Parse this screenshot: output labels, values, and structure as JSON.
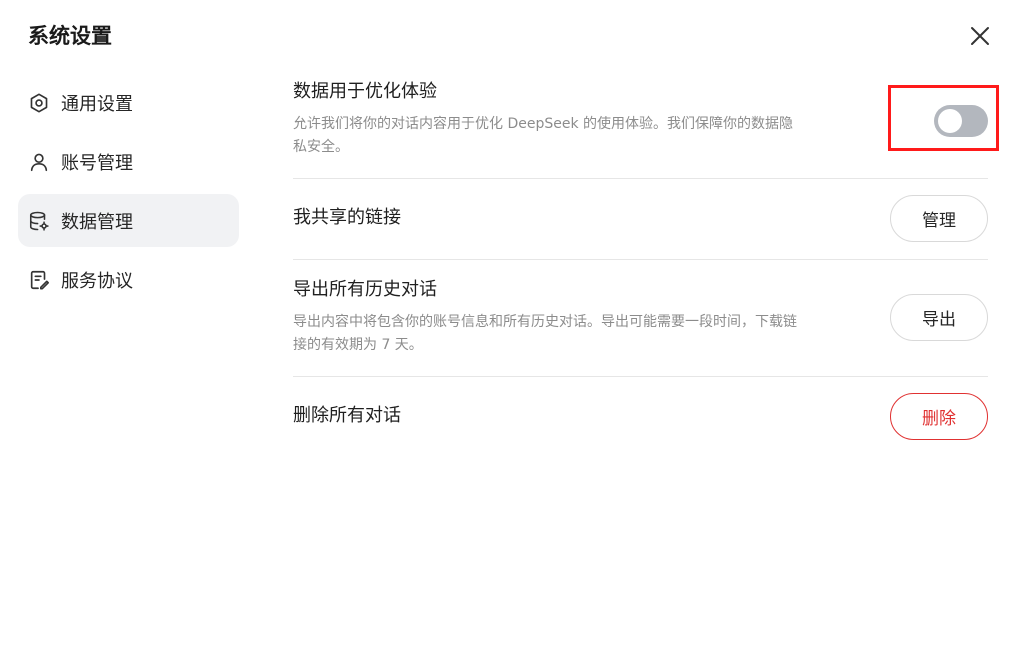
{
  "dialog": {
    "title": "系统设置"
  },
  "sidebar": {
    "items": [
      {
        "label": "通用设置",
        "icon": "gear-icon",
        "active": false
      },
      {
        "label": "账号管理",
        "icon": "user-icon",
        "active": false
      },
      {
        "label": "数据管理",
        "icon": "database-icon",
        "active": true
      },
      {
        "label": "服务协议",
        "icon": "document-icon",
        "active": false
      }
    ]
  },
  "settings": {
    "optimize": {
      "title": "数据用于优化体验",
      "desc": "允许我们将你的对话内容用于优化 DeepSeek 的使用体验。我们保障你的数据隐私安全。",
      "toggle_on": false
    },
    "shared_links": {
      "title": "我共享的链接",
      "button": "管理"
    },
    "export": {
      "title": "导出所有历史对话",
      "desc": "导出内容中将包含你的账号信息和所有历史对话。导出可能需要一段时间，下载链接的有效期为 7 天。",
      "button": "导出"
    },
    "delete": {
      "title": "删除所有对话",
      "button": "删除"
    }
  },
  "colors": {
    "danger": "#e03131",
    "highlight": "#ff1a1a",
    "toggle_off": "#b3b7be",
    "active_bg": "#f1f2f4"
  }
}
